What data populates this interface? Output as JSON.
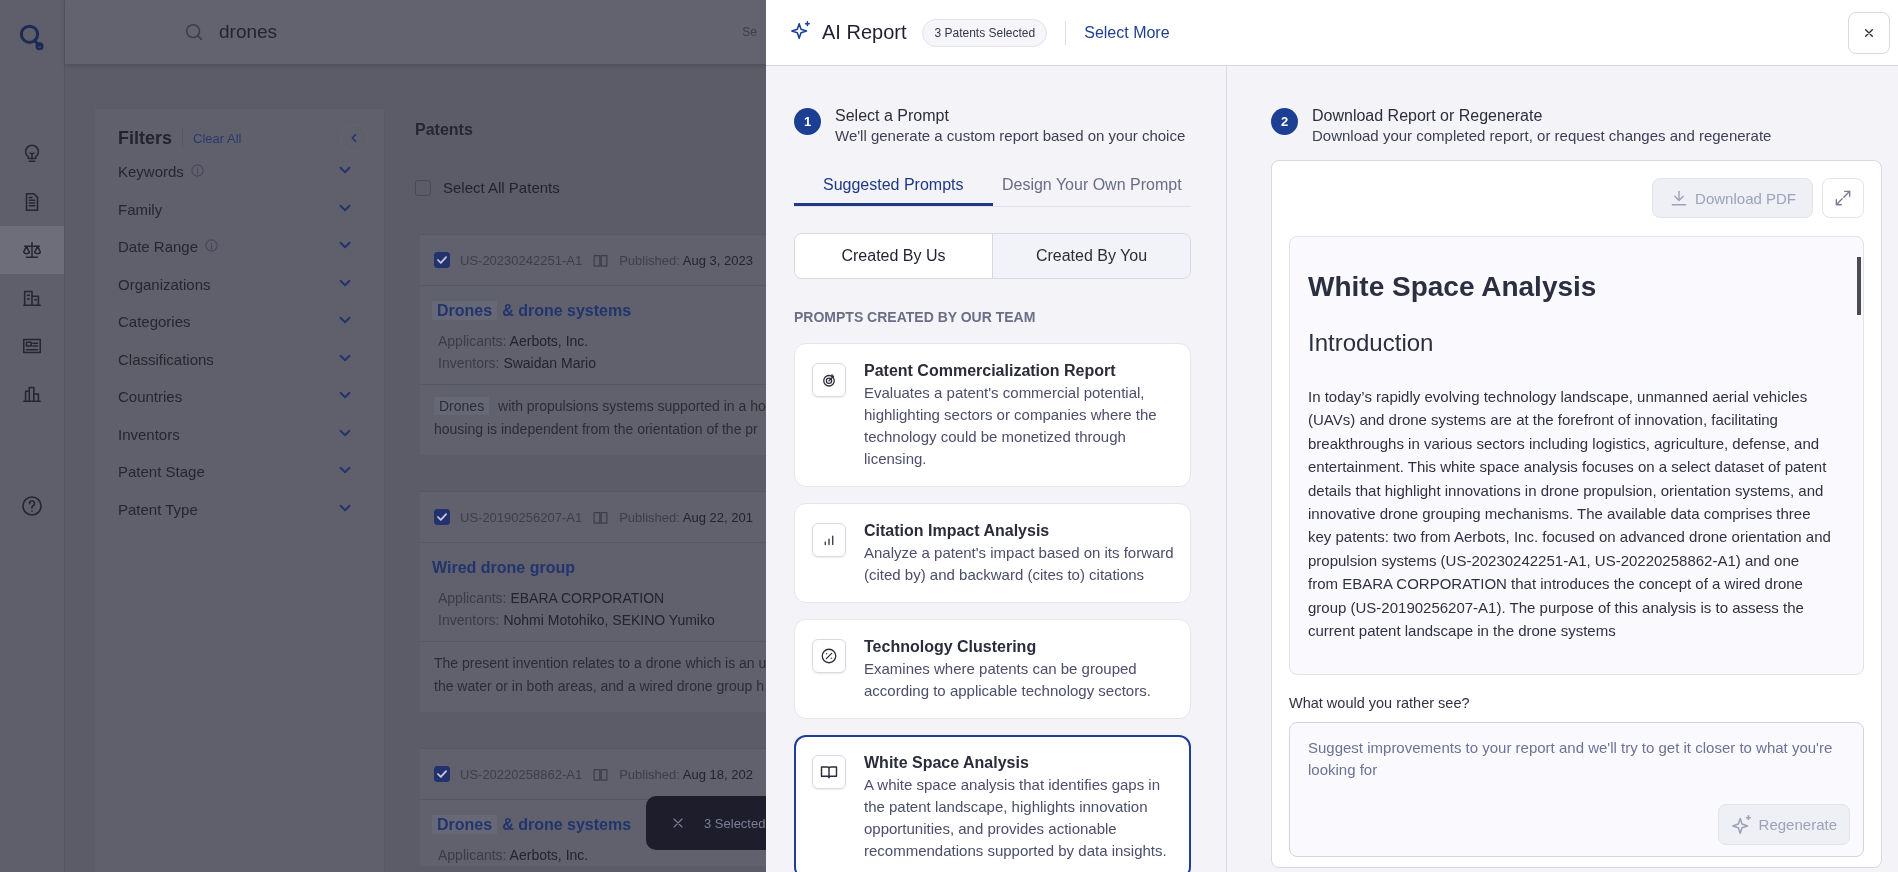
{
  "app": {
    "logo": {
      "kind": "logo"
    },
    "rail": [
      {
        "kind": "bulb",
        "selected": false
      },
      {
        "kind": "document",
        "selected": false
      },
      {
        "kind": "scale",
        "selected": true
      },
      {
        "kind": "building",
        "selected": false
      },
      {
        "kind": "list",
        "selected": false
      },
      {
        "kind": "chart",
        "selected": false
      },
      {
        "kind": "help",
        "selected": false
      }
    ],
    "search": {
      "value": "drones",
      "cut_label": "Se"
    },
    "filters": {
      "title": "Filters",
      "clear": "Clear All",
      "items": [
        {
          "label": "Keywords",
          "info": true
        },
        {
          "label": "Family",
          "info": false
        },
        {
          "label": "Date Range",
          "info": true
        },
        {
          "label": "Organizations",
          "info": false
        },
        {
          "label": "Categories",
          "info": false
        },
        {
          "label": "Classifications",
          "info": false
        },
        {
          "label": "Countries",
          "info": false
        },
        {
          "label": "Inventors",
          "info": false
        },
        {
          "label": "Patent Stage",
          "info": false
        },
        {
          "label": "Patent Type",
          "info": false
        }
      ]
    },
    "patents": {
      "title": "Patents",
      "select_all": {
        "label": "Select All Patents",
        "checked": false
      },
      "cards": [
        {
          "checked": true,
          "number": "US-20230242251-A1",
          "published_label": "Published:",
          "published": "Aug 3, 2023",
          "title": [
            {
              "text": "Drones",
              "highlight": true
            },
            {
              "text": "& drone systems",
              "highlight": false
            }
          ],
          "applicants_label": "Applicants:",
          "applicants": "Aerbots, Inc.",
          "inventors_label": "Inventors:",
          "inventors": "Swaidan Mario",
          "abstract": [
            [
              {
                "text": "Drones",
                "highlight": true
              },
              {
                "text": " with propulsions systems supported in a ho",
                "highlight": false
              }
            ],
            [
              {
                "text": "housing is independent from the orientation of the pr",
                "highlight": false
              }
            ]
          ]
        },
        {
          "checked": true,
          "number": "US-20190256207-A1",
          "published_label": "Published:",
          "published": "Aug 22, 201",
          "title": [
            {
              "text": "Wired drone group",
              "highlight": false
            }
          ],
          "applicants_label": "Applicants:",
          "applicants": "EBARA CORPORATION",
          "inventors_label": "Inventors:",
          "inventors": "Nohmi Motohiko, SEKINO Yumiko",
          "abstract": [
            [
              {
                "text": "The present invention relates to a drone which is an u",
                "highlight": false
              }
            ],
            [
              {
                "text": "the water or in both areas, and a wired drone group h",
                "highlight": false
              }
            ]
          ]
        },
        {
          "checked": true,
          "number": "US-20220258862-A1",
          "published_label": "Published:",
          "published": "Aug 18, 202",
          "title": [
            {
              "text": "Drones",
              "highlight": true
            },
            {
              "text": "& drone systems",
              "highlight": false
            }
          ],
          "applicants_label": "Applicants:",
          "applicants": "Aerbots, Inc."
        }
      ]
    },
    "toast": {
      "label": "3 Selected"
    }
  },
  "drawer": {
    "title": "AI Report",
    "chip": "3 Patents Selected",
    "link": "Select More",
    "left": {
      "step": "1",
      "title": "Select a Prompt",
      "subtitle": "We'll generate a custom report based on your choice",
      "tabs": [
        {
          "label": "Suggested Prompts",
          "selected": true
        },
        {
          "label": "Design Your Own Prompt",
          "selected": false
        }
      ],
      "segments": [
        {
          "label": "Created By Us",
          "selected": true
        },
        {
          "label": "Created By You",
          "selected": false
        }
      ],
      "section": "PROMPTS CREATED BY OUR TEAM",
      "prompts": [
        {
          "kind": "target",
          "title": "Patent Commercialization Report",
          "description": "Evaluates a patent's commercial potential, highlighting sectors or companies where the technology could be monetized through licensing.",
          "selected": false
        },
        {
          "kind": "bars",
          "title": "Citation Impact Analysis",
          "description": "Analyze a patent's impact based on its forward (cited by) and backward (cites to) citations",
          "selected": false
        },
        {
          "kind": "percent",
          "title": "Technology Clustering",
          "description": "Examines where patents can be grouped according to applicable technology sectors.",
          "selected": false
        },
        {
          "kind": "book",
          "title": "White Space Analysis",
          "description": "A white space analysis that identifies gaps in the patent landscape, highlights innovation opportunities, and provides actionable recommendations supported by data insights.",
          "selected": true
        }
      ]
    },
    "right": {
      "step": "2",
      "title": "Download Report or Regenerate",
      "subtitle": "Download your completed report, or request changes and regenerate",
      "download": {
        "label": "Download PDF",
        "disabled": true
      },
      "report": {
        "title": "White Space Analysis",
        "heading": "Introduction",
        "paragraph": "In today’s rapidly evolving technology landscape, unmanned aerial vehicles (UAVs) and drone systems are at the forefront of innovation, facilitating breakthroughs in various sectors including logistics, agriculture, defense, and entertainment. This white space analysis focuses on a select dataset of patent details that highlight innovations in drone propulsion, orientation systems, and innovative drone grouping mechanisms. The available data comprises three key patents: two from Aerbots, Inc. focused on advanced drone orientation and propulsion systems (US-20230242251-A1, US-20220258862-A1) and one from EBARA CORPORATION that introduces the concept of a wired drone group (US-20190256207-A1). The purpose of this analysis is to assess the current patent landscape in the drone systems"
      },
      "feedback_label": "What would you rather see?",
      "feedback": {
        "placeholder": "Suggest improvements to your report and we'll try to get it closer to what you're looking for"
      },
      "regenerate": {
        "label": "Regenerate",
        "disabled": true
      }
    }
  }
}
